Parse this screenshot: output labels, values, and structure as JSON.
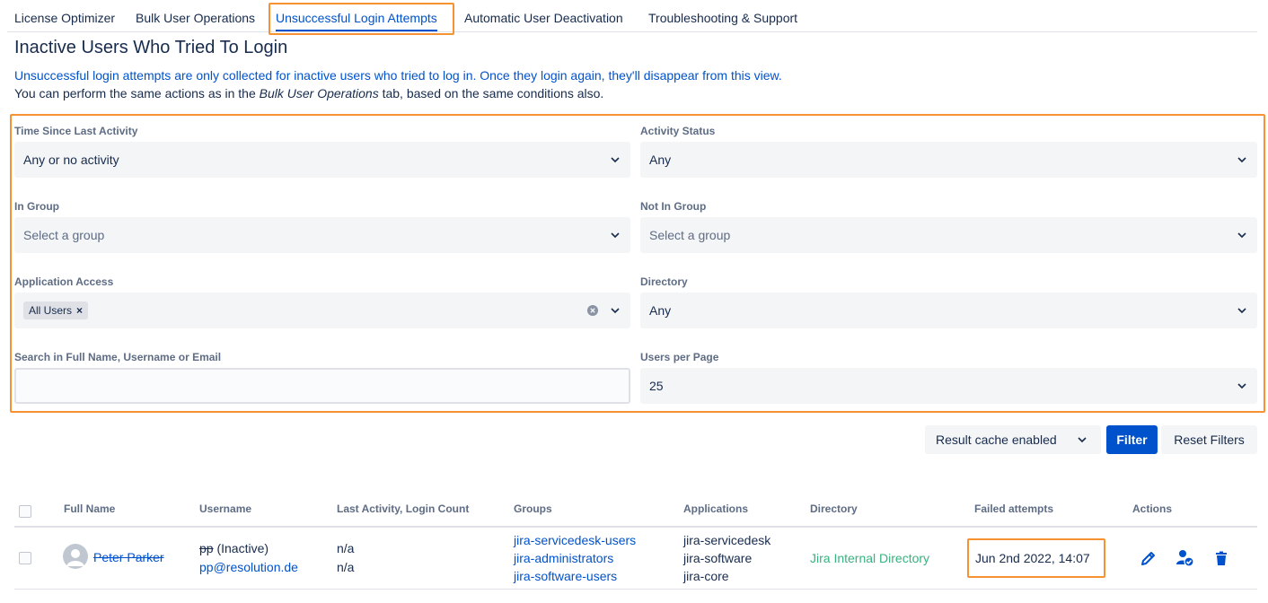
{
  "tabs": [
    {
      "label": "License Optimizer"
    },
    {
      "label": "Bulk User Operations"
    },
    {
      "label": "Unsuccessful Login Attempts"
    },
    {
      "label": "Automatic User Deactivation"
    },
    {
      "label": "Troubleshooting & Support"
    }
  ],
  "active_tab": "Unsuccessful Login Attempts",
  "page_title": "Inactive Users Who Tried To Login",
  "info_line1": "Unsuccessful login attempts are only collected for inactive users who tried to log in. Once they login again, they'll disappear from this view.",
  "info_line2_prefix": "You can perform the same actions as in the ",
  "info_line2_em": "Bulk User Operations",
  "info_line2_suffix": " tab, based on the same conditions also.",
  "filters": {
    "time_since_label": "Time Since Last Activity",
    "time_since_value": "Any or no activity",
    "activity_status_label": "Activity Status",
    "activity_status_value": "Any",
    "in_group_label": "In Group",
    "in_group_placeholder": "Select a group",
    "not_in_group_label": "Not In Group",
    "not_in_group_placeholder": "Select a group",
    "app_access_label": "Application Access",
    "app_access_chip": "All Users",
    "app_access_chip_remove": "×",
    "directory_label": "Directory",
    "directory_value": "Any",
    "search_label": "Search in Full Name, Username or Email",
    "search_value": "",
    "users_per_page_label": "Users per Page",
    "users_per_page_value": "25"
  },
  "buttons": {
    "cache": "Result cache enabled",
    "filter": "Filter",
    "reset": "Reset Filters"
  },
  "table": {
    "headers": [
      "Full Name",
      "Username",
      "Last Activity, Login Count",
      "Groups",
      "Applications",
      "Directory",
      "Failed attempts",
      "Actions"
    ],
    "rows": [
      {
        "full_name": "Peter Parker",
        "username": "pp",
        "username_status": " (Inactive)",
        "email": "pp@resolution.de",
        "last_activity": "n/a",
        "login_count": "n/a",
        "groups": [
          "jira-servicedesk-users",
          "jira-administrators",
          "jira-software-users"
        ],
        "applications": [
          "jira-servicedesk",
          "jira-software",
          "jira-core"
        ],
        "directory": "Jira Internal Directory",
        "failed_attempts": "Jun 2nd 2022, 14:07"
      }
    ]
  },
  "icons": {
    "chevron": "chevron-down-icon",
    "clear": "clear-icon",
    "edit": "pencil-icon",
    "user_check": "user-check-icon",
    "delete": "trash-icon",
    "avatar": "avatar-icon"
  },
  "colors": {
    "accent": "#0052cc",
    "highlight": "#f79232",
    "directory": "#36b37e"
  }
}
